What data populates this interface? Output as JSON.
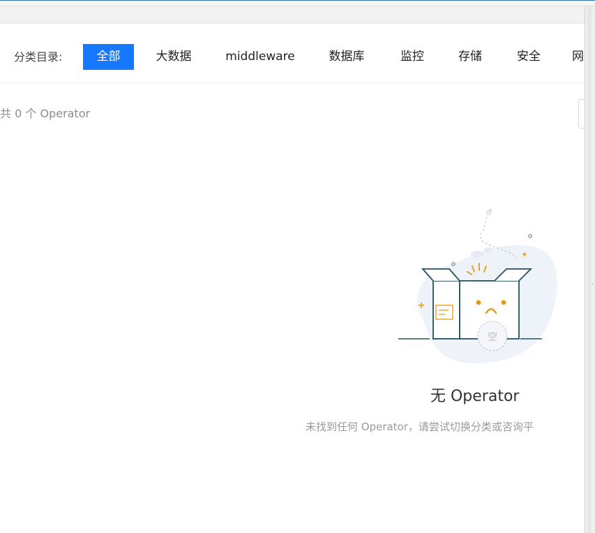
{
  "category_bar": {
    "label": "分类目录:",
    "items": [
      {
        "label": "全部",
        "active": true
      },
      {
        "label": "大数据",
        "active": false
      },
      {
        "label": "middleware",
        "active": false
      },
      {
        "label": "数据库",
        "active": false
      },
      {
        "label": "监控",
        "active": false
      },
      {
        "label": "存储",
        "active": false
      },
      {
        "label": "安全",
        "active": false
      },
      {
        "label": "网",
        "active": false
      }
    ]
  },
  "summary": {
    "count_text": "共 0 个 Operator"
  },
  "empty_state": {
    "icon": "empty-box-illustration",
    "badge_text": "空",
    "title": "无 Operator",
    "description": "未找到任何 Operator，请尝试切换分类或咨询平"
  },
  "colors": {
    "accent": "#1677ff",
    "illustration_stroke": "#24505e",
    "illustration_accent": "#e59a12",
    "illustration_bg": "#eef3fa"
  }
}
